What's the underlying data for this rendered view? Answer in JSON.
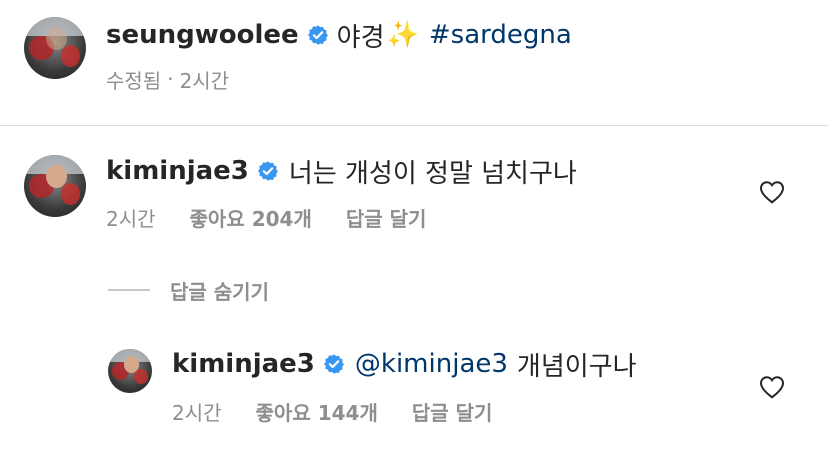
{
  "caption": {
    "username": "seungwoolee",
    "text": "야경",
    "emoji": "✨",
    "hashtag": "#sardegna",
    "edited_label": "수정됨",
    "separator": "·",
    "time": "2시간"
  },
  "comments": [
    {
      "username": "kiminjae3",
      "text": "너는 개성이 정말 넘치구나",
      "time": "2시간",
      "likes_label": "좋아요 204개",
      "reply_label": "답글 달기"
    }
  ],
  "hide_replies_label": "답글 숨기기",
  "replies": [
    {
      "username": "kiminjae3",
      "mention": "@kiminjae3",
      "text": "개념이구나",
      "time": "2시간",
      "likes_label": "좋아요 144개",
      "reply_label": "답글 달기"
    }
  ],
  "colors": {
    "verified": "#3897f0",
    "link": "#00376b",
    "secondary_text": "#8e8e8e",
    "divider": "#dbdbdb"
  },
  "icons": {
    "verified": "verified-badge-icon",
    "heart": "heart-outline-icon"
  }
}
